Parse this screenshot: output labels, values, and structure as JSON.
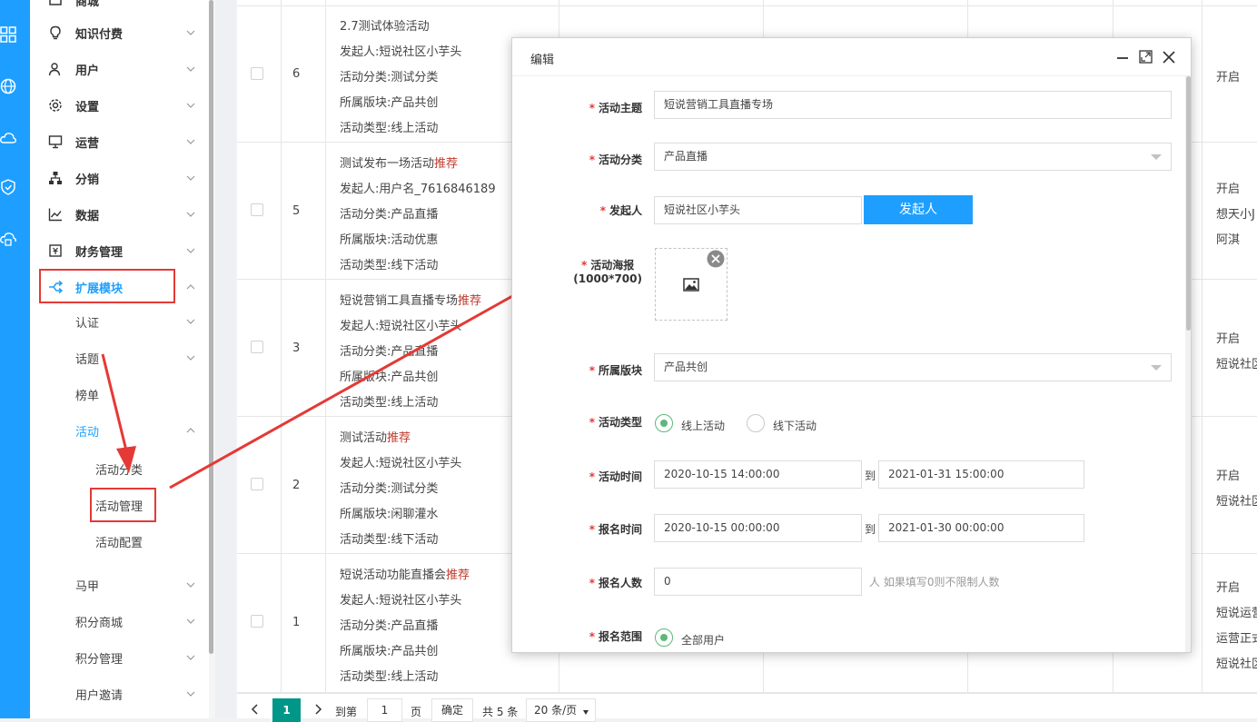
{
  "sidebar": {
    "top_partial": "商城",
    "items": [
      {
        "label": "知识付费",
        "icon": "bulb-icon"
      },
      {
        "label": "用户",
        "icon": "user-icon"
      },
      {
        "label": "设置",
        "icon": "gear-icon"
      },
      {
        "label": "运营",
        "icon": "monitor-icon"
      },
      {
        "label": "分销",
        "icon": "network-icon"
      },
      {
        "label": "数据",
        "icon": "chart-icon"
      },
      {
        "label": "财务管理",
        "icon": "finance-icon"
      },
      {
        "label": "扩展模块",
        "icon": "extend-icon"
      }
    ],
    "sub": [
      {
        "label": "认证"
      },
      {
        "label": "话题"
      },
      {
        "label": "榜单"
      },
      {
        "label": "活动"
      }
    ],
    "leaves": [
      {
        "label": "活动分类"
      },
      {
        "label": "活动管理"
      },
      {
        "label": "活动配置"
      }
    ],
    "sub2": [
      {
        "label": "马甲"
      },
      {
        "label": "积分商城"
      },
      {
        "label": "积分管理"
      },
      {
        "label": "用户邀请"
      }
    ],
    "active_color": "#1e9fff"
  },
  "table": {
    "rows": [
      {
        "num": "6",
        "title": "2.7测试体验活动",
        "tag": "",
        "initiator": "发起人:短说社区小芋头",
        "category": "活动分类:测试分类",
        "block": "所属版块:产品共创",
        "type": "活动类型:线上活动",
        "status": [
          "开启"
        ]
      },
      {
        "num": "5",
        "title": "测试发布一场活动",
        "tag": "推荐",
        "initiator": "发起人:用户名_7616846189",
        "category": "活动分类:产品直播",
        "block": "所属版块:活动优惠",
        "type": "活动类型:线下活动",
        "status": [
          "开启",
          "想天小J",
          "阿淇"
        ]
      },
      {
        "num": "3",
        "title": "短说营销工具直播专场",
        "tag": "推荐",
        "initiator": "发起人:短说社区小芋头",
        "category": "活动分类:产品直播",
        "block": "所属版块:产品共创",
        "type": "活动类型:线上活动",
        "status": [
          "开启",
          "短说社区"
        ]
      },
      {
        "num": "2",
        "title": "测试活动",
        "tag": "推荐",
        "initiator": "发起人:短说社区小芋头",
        "category": "活动分类:测试分类",
        "block": "所属版块:闲聊灌水",
        "type": "活动类型:线下活动",
        "status": [
          "开启",
          "短说社区"
        ]
      },
      {
        "num": "1",
        "title": "短说活动功能直播会",
        "tag": "推荐",
        "initiator": "发起人:短说社区小芋头",
        "category": "活动分类:产品直播",
        "block": "所属版块:产品共创",
        "type": "活动类型:线上活动",
        "status": [
          "开启",
          "短说运营",
          "运营正式",
          "短说社区"
        ]
      }
    ]
  },
  "pager": {
    "current": "1",
    "goto_label": "到第",
    "goto_value": "1",
    "page_label": "页",
    "confirm": "确定",
    "total": "共 5 条",
    "per_page": "20 条/页"
  },
  "modal": {
    "title": "编辑",
    "fields": {
      "theme_label": "活动主题",
      "theme_value": "短说营销工具直播专场",
      "category_label": "活动分类",
      "category_value": "产品直播",
      "initiator_label": "发起人",
      "initiator_value": "短说社区小芋头",
      "initiator_button": "发起人",
      "poster_label": "活动海报",
      "poster_size": "(1000*700)",
      "block_label": "所属版块",
      "block_value": "产品共创",
      "type_label": "活动类型",
      "type_online": "线上活动",
      "type_offline": "线下活动",
      "time_label": "活动时间",
      "time_start": "2020-10-15 14:00:00",
      "time_to": "到",
      "time_end": "2021-01-31 15:00:00",
      "signup_label": "报名时间",
      "signup_start": "2020-10-15 00:00:00",
      "signup_to": "到",
      "signup_end": "2021-01-30 00:00:00",
      "count_label": "报名人数",
      "count_value": "0",
      "count_hint": "人 如果填写0则不限制人数",
      "range_label": "报名范围",
      "range_all": "全部用户"
    }
  }
}
